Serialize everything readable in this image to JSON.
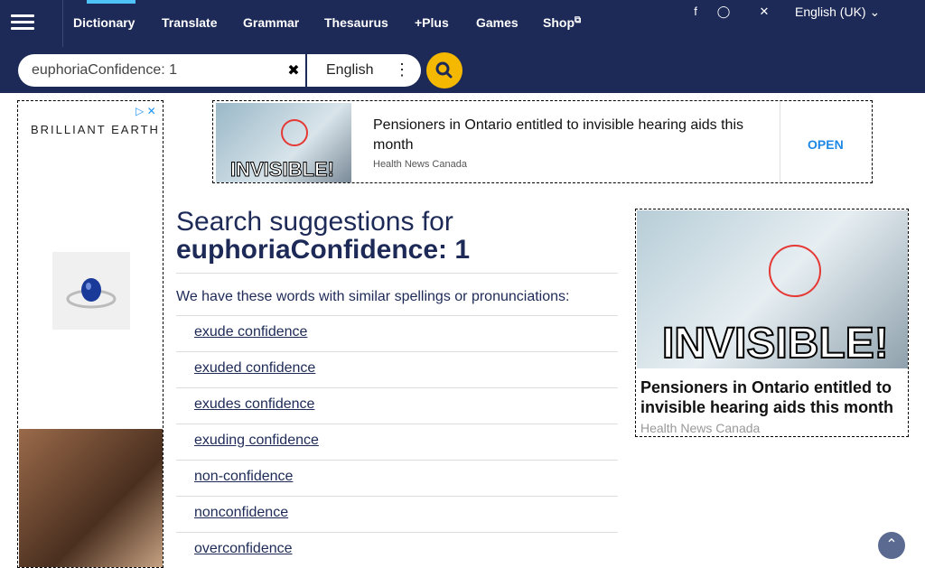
{
  "nav": {
    "items": [
      {
        "label": "Dictionary"
      },
      {
        "label": "Translate"
      },
      {
        "label": "Grammar"
      },
      {
        "label": "Thesaurus"
      },
      {
        "label": "+Plus"
      },
      {
        "label": "Games"
      },
      {
        "label": "Shop"
      }
    ],
    "social_icons": [
      "facebook-icon",
      "instagram-icon",
      "x-twitter-icon"
    ],
    "language": "English (UK)"
  },
  "search": {
    "value": "euphoriaConfidence: 1",
    "dictionary": "English"
  },
  "left_ad": {
    "brand": "BRILLIANT EARTH"
  },
  "top_ad": {
    "banner": "INVISIBLE!",
    "title": "Pensioners in Ontario entitled to invisible hearing aids this month",
    "source": "Health News Canada",
    "cta": "OPEN"
  },
  "main": {
    "heading": "Search suggestions for",
    "term": "euphoriaConfidence: 1",
    "intro": "We have these words with similar spellings or pronunciations:",
    "suggestions": [
      "exude confidence",
      "exuded confidence",
      "exudes confidence",
      "exuding confidence",
      "non-confidence",
      "nonconfidence",
      "overconfidence"
    ]
  },
  "right_ad": {
    "banner": "INVISIBLE!",
    "title": "Pensioners in Ontario entitled to invisible hearing aids this month",
    "source": "Health News Canada"
  },
  "colors": {
    "header": "#1d2a57",
    "accent": "#f5b800",
    "link": "#1d2a57"
  }
}
